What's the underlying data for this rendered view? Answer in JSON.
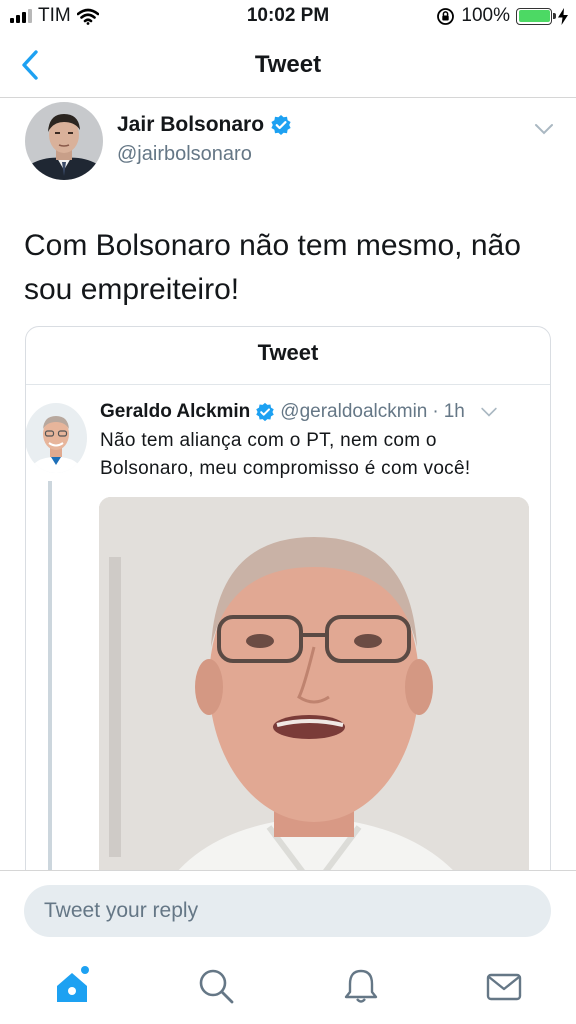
{
  "status_bar": {
    "carrier": "TIM",
    "time": "10:02 PM",
    "battery_percent": "100%",
    "signal_bars_active": 3,
    "signal_bars_total": 4,
    "battery_color": "#4cd964"
  },
  "nav": {
    "title": "Tweet",
    "back_icon": "chevron-left-icon"
  },
  "tweet": {
    "author_name": "Jair Bolsonaro",
    "author_handle": "@jairbolsonaro",
    "verified": true,
    "text": "Com Bolsonaro não tem mesmo, não sou empreiteiro!"
  },
  "quote": {
    "header_title": "Tweet",
    "author_name": "Geraldo Alckmin",
    "author_handle": "@geraldoalckmin",
    "separator": "·",
    "time": "1h",
    "verified": true,
    "text": "Não tem aliança com o PT, nem com o Bolsonaro, meu compromisso é com você!"
  },
  "reply": {
    "placeholder": "Tweet your reply"
  },
  "tabs": [
    {
      "name": "home",
      "icon": "home-icon",
      "active": true
    },
    {
      "name": "search",
      "icon": "search-icon",
      "active": false
    },
    {
      "name": "notifications",
      "icon": "bell-icon",
      "active": false
    },
    {
      "name": "messages",
      "icon": "mail-icon",
      "active": false
    }
  ],
  "colors": {
    "accent": "#1da1f2",
    "icon_gray": "#657786"
  }
}
